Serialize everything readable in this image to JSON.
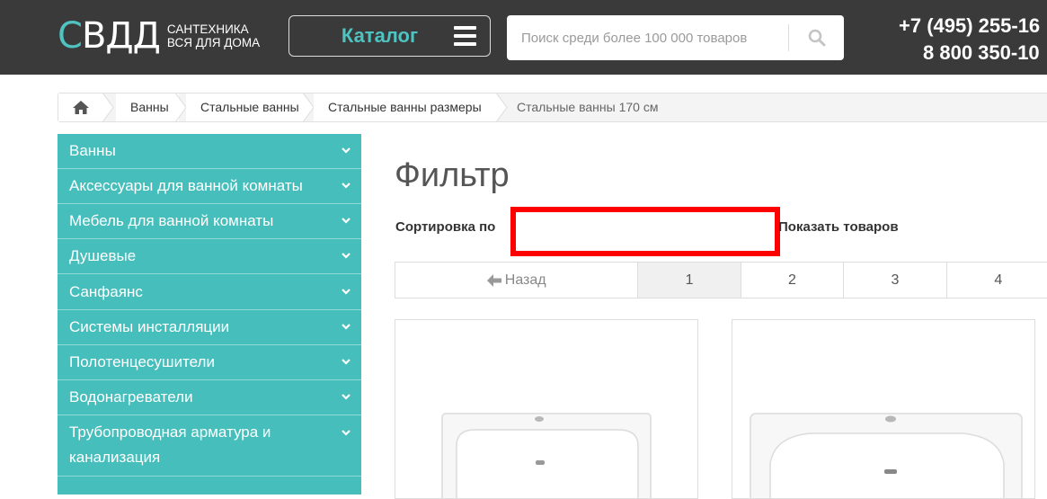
{
  "header": {
    "logo_text": "СВДД",
    "logo_first_letter": "С",
    "logo_rest": "ВДД",
    "logo_tagline": "Сантехника вся для дома",
    "catalog_label": "Каталог",
    "search_placeholder": "Поиск среди более 100 000 товаров",
    "phone1": "+7 (495) 255-16",
    "phone2": "8 800 350-10",
    "accent_color": "#4fc3c1"
  },
  "breadcrumb": {
    "items": [
      "Ванны",
      "Стальные ванны",
      "Стальные ванны размеры"
    ],
    "current": "Стальные ванны 170 см"
  },
  "sidebar": {
    "items": [
      "Ванны",
      "Аксессуары для ванной комнаты",
      "Мебель для ванной комнаты",
      "Душевые",
      "Санфаянс",
      "Системы инсталляции",
      "Полотенцесушители",
      "Водонагреватели",
      "Трубопроводная арматура и канализация"
    ],
    "background_color": "#46bebc"
  },
  "filter": {
    "title": "Фильтр",
    "sort_label": "Сортировка по",
    "show_label": "Показать товаров"
  },
  "pagination": {
    "back_label": "Назад",
    "pages": [
      "1",
      "2",
      "3",
      "4"
    ],
    "active_page": "1"
  }
}
